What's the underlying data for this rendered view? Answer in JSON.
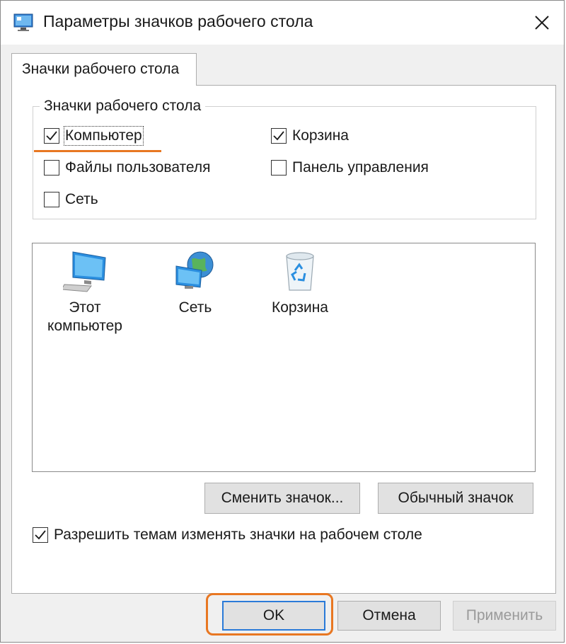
{
  "window": {
    "title": "Параметры значков рабочего стола",
    "title_icon": "desktop-settings-icon",
    "close_icon": "close-icon"
  },
  "tab": {
    "label": "Значки рабочего стола"
  },
  "group": {
    "legend": "Значки рабочего стола",
    "checkboxes": [
      {
        "label": "Компьютер",
        "checked": true,
        "accesskey": "К"
      },
      {
        "label": "Корзина",
        "checked": true,
        "accesskey": "К"
      },
      {
        "label": "Файлы пользователя",
        "checked": false,
        "accesskey": "Ф"
      },
      {
        "label": "Панель управления",
        "checked": false,
        "accesskey": "П"
      },
      {
        "label": "Сеть",
        "checked": false,
        "accesskey": "С"
      }
    ]
  },
  "icon_view": {
    "items": [
      {
        "caption_line1": "Этот",
        "caption_line2": "компьютер",
        "icon": "computer-icon"
      },
      {
        "caption": "Сеть",
        "icon": "network-icon"
      },
      {
        "caption": "Корзина",
        "icon": "recycle-bin-icon"
      }
    ]
  },
  "buttons": {
    "change_icon": "Сменить значок...",
    "default_icon": "Обычный значок",
    "ok": "OK",
    "cancel": "Отмена",
    "apply": "Применить"
  },
  "allow_themes": {
    "label": "Разрешить темам изменять значки на рабочем столе",
    "checked": true
  },
  "colors": {
    "accent_highlight": "#e87722",
    "default_button_border": "#2a7ad8",
    "monitor_blue": "#3a9ee4"
  }
}
